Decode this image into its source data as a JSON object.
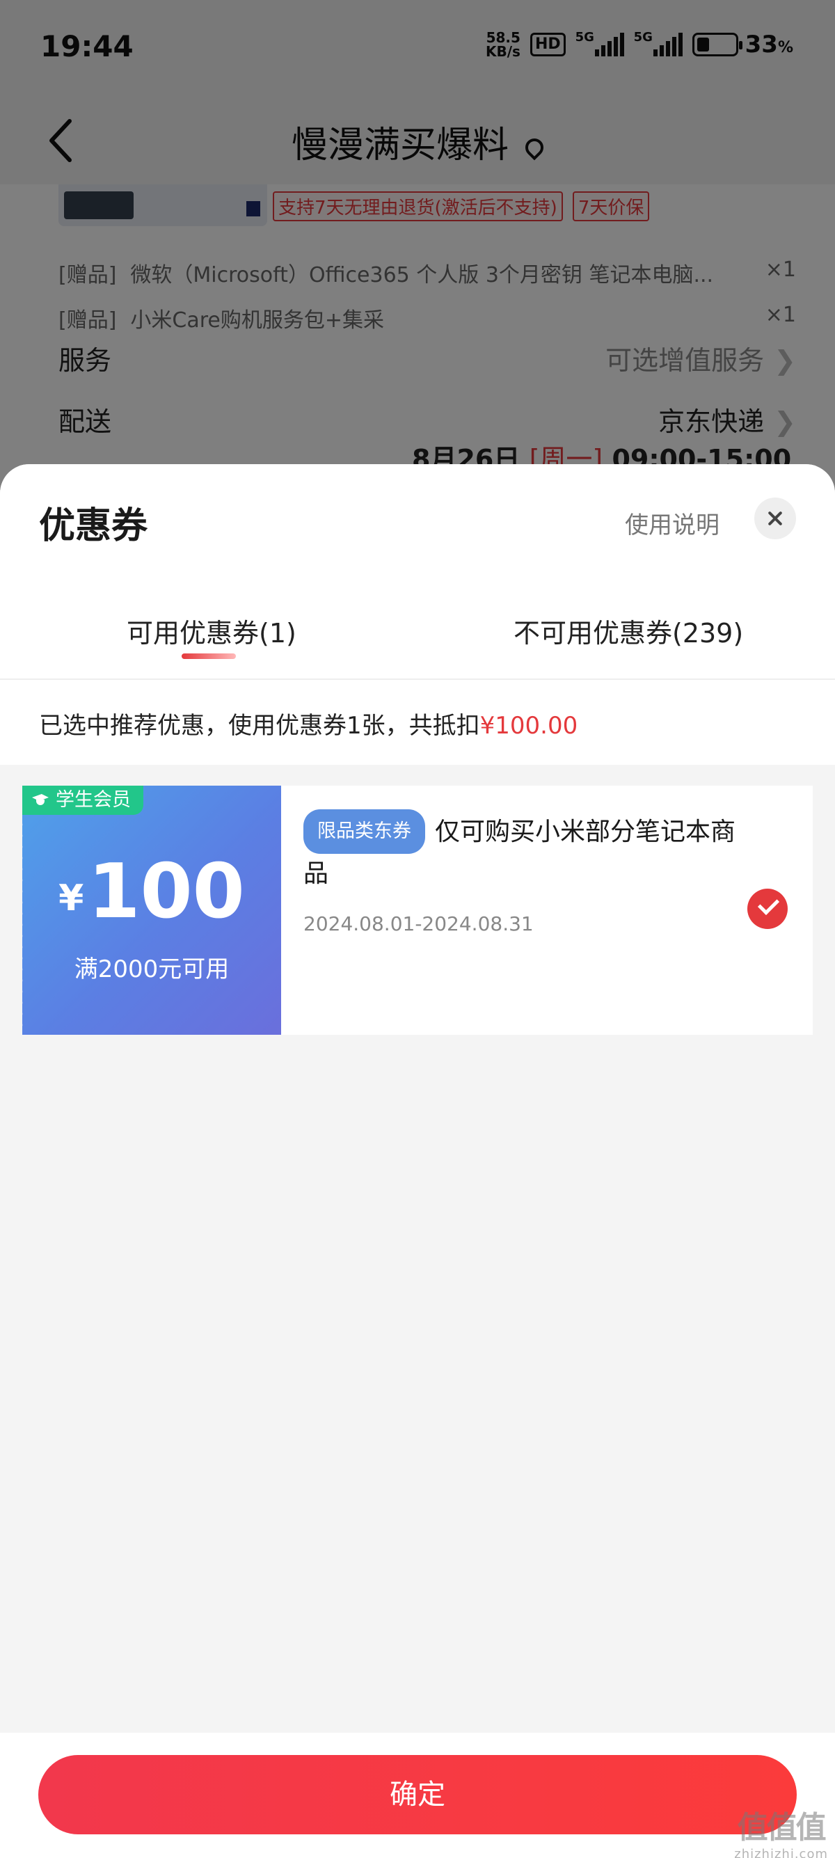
{
  "status_bar": {
    "time": "19:44",
    "net_speed_value": "58.5",
    "net_speed_unit": "KB/s",
    "hd_badge": "HD",
    "sim1_label": "5G",
    "sim2_label": "5G",
    "battery_percent": "33",
    "battery_unit": "%",
    "battery_level": 0.33
  },
  "nav": {
    "title": "慢漫满买爆料"
  },
  "order": {
    "tags": [
      "支持7天无理由退货(激活后不支持)",
      "7天价保"
    ],
    "gifts": [
      {
        "prefix": "[赠品]",
        "text": "微软（Microsoft）Office365 个人版 3个月密钥 笔记本电脑...",
        "qty": "×1"
      },
      {
        "prefix": "[赠品]",
        "text": "小米Care购机服务包+集采",
        "qty": "×1"
      }
    ],
    "service_label": "服务",
    "service_value": "可选增值服务",
    "delivery_label": "配送",
    "delivery_value": "京东快递",
    "delivery_date": "8月26日",
    "delivery_weekday": "[周一]",
    "delivery_time": "09:00-15:00"
  },
  "sheet": {
    "title": "优惠券",
    "help_label": "使用说明",
    "tabs": [
      {
        "label": "可用优惠券(1)",
        "active": true
      },
      {
        "label": "不可用优惠券(239)",
        "active": false
      }
    ],
    "summary_prefix": "已选中推荐优惠，使用优惠券1张，共抵扣",
    "summary_amount": "¥100.00"
  },
  "coupon": {
    "badge": "学生会员",
    "currency": "¥",
    "amount": "100",
    "condition": "满2000元可用",
    "type_tag": "限品类东券",
    "description": "仅可购买小米部分笔记本商品",
    "dates": "2024.08.01-2024.08.31",
    "selected": true
  },
  "footer": {
    "confirm_label": "确定"
  },
  "watermark": {
    "logo": "值值值",
    "site": "zhizhizhi.com"
  },
  "colors": {
    "accent_red": "#e4393c",
    "coupon_blue": "#5b7fe3",
    "badge_green": "#22c68a"
  }
}
